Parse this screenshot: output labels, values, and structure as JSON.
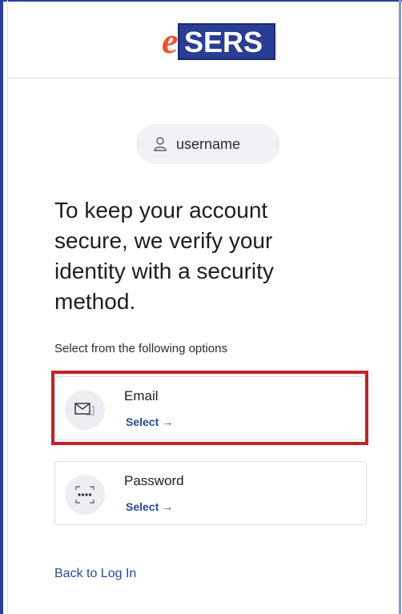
{
  "header": {
    "logo_letter": "e",
    "logo_text": "SERS",
    "colors": {
      "logo_e": "#e8532b",
      "logo_box": "#2a3d94"
    }
  },
  "user": {
    "icon": "person-icon",
    "name": "username"
  },
  "main": {
    "heading": "To keep your account secure, we verify your identity with a security method.",
    "subtext": "Select from the following options"
  },
  "options": [
    {
      "icon": "envelope-icon",
      "title": "Email",
      "select_label": "Select",
      "arrow": "→",
      "highlighted": true
    },
    {
      "icon": "password-dots-icon",
      "title": "Password",
      "select_label": "Select",
      "arrow": "→",
      "highlighted": false
    }
  ],
  "footer": {
    "back_link": "Back to Log In"
  },
  "colors": {
    "link": "#2a4a9a",
    "highlight": "#c62027",
    "frame": "#2a3f9e"
  }
}
